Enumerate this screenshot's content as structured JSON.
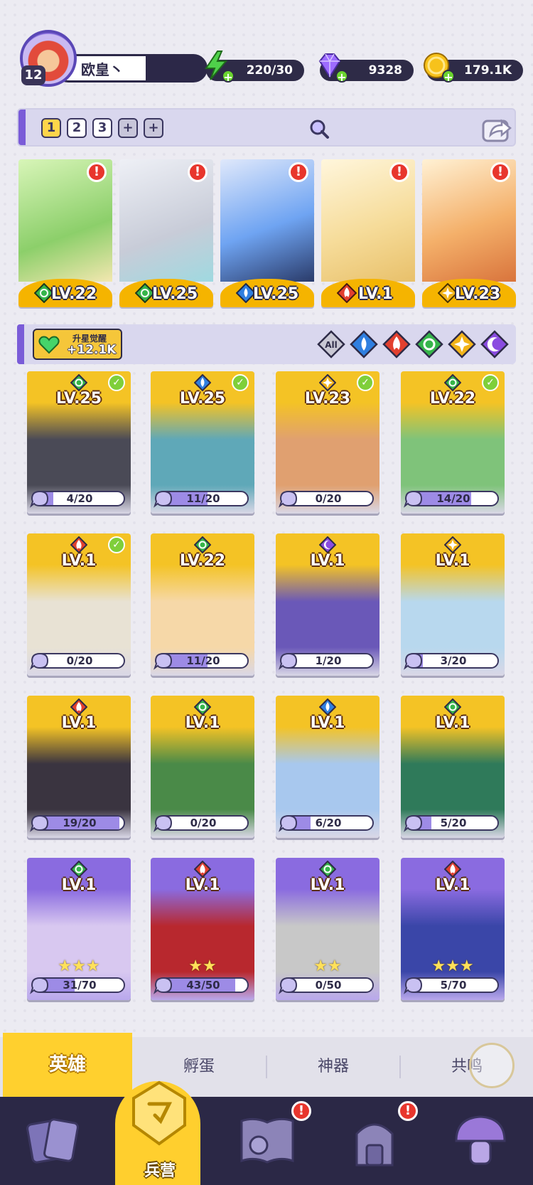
{
  "player": {
    "level": "12",
    "name": "欧皇丶"
  },
  "resources": [
    {
      "id": "energy",
      "value": "220/30",
      "icon": "lightning-icon",
      "color": "#4fd14a"
    },
    {
      "id": "gems",
      "value": "9328",
      "icon": "diamond-icon",
      "color": "#9d6cff"
    },
    {
      "id": "gold",
      "value": "179.1K",
      "icon": "coin-icon",
      "color": "#f7c21b"
    }
  ],
  "team_tabs": [
    "1",
    "2",
    "3",
    "+",
    "+"
  ],
  "team": [
    {
      "level": "LV.22",
      "element": "nature",
      "alert": "!"
    },
    {
      "level": "LV.25",
      "element": "nature",
      "alert": "!"
    },
    {
      "level": "LV.25",
      "element": "water",
      "alert": "!"
    },
    {
      "level": "LV.1",
      "element": "fire",
      "alert": "!"
    },
    {
      "level": "LV.23",
      "element": "light",
      "alert": "!"
    }
  ],
  "awaken": {
    "label": "升星觉醒",
    "value": "+12.1K"
  },
  "filters": [
    "All",
    "water",
    "fire",
    "nature",
    "light",
    "dark"
  ],
  "heroes": [
    {
      "level": "LV.25",
      "element": "nature",
      "checked": true,
      "progress": "4/20",
      "fraction": 0.2,
      "rarity": "gold"
    },
    {
      "level": "LV.25",
      "element": "water",
      "checked": true,
      "progress": "11/20",
      "fraction": 0.55,
      "rarity": "gold"
    },
    {
      "level": "LV.23",
      "element": "light",
      "checked": true,
      "progress": "0/20",
      "fraction": 0,
      "rarity": "gold"
    },
    {
      "level": "LV.22",
      "element": "nature",
      "checked": true,
      "progress": "14/20",
      "fraction": 0.7,
      "rarity": "gold"
    },
    {
      "level": "LV.1",
      "element": "fire",
      "checked": true,
      "progress": "0/20",
      "fraction": 0,
      "rarity": "gold"
    },
    {
      "level": "LV.22",
      "element": "nature",
      "checked": false,
      "progress": "11/20",
      "fraction": 0.55,
      "rarity": "gold"
    },
    {
      "level": "LV.1",
      "element": "dark",
      "checked": false,
      "progress": "1/20",
      "fraction": 0.05,
      "rarity": "gold"
    },
    {
      "level": "LV.1",
      "element": "light",
      "checked": false,
      "progress": "3/20",
      "fraction": 0.15,
      "rarity": "gold"
    },
    {
      "level": "LV.1",
      "element": "fire",
      "checked": false,
      "progress": "19/20",
      "fraction": 0.95,
      "rarity": "gold"
    },
    {
      "level": "LV.1",
      "element": "nature",
      "checked": false,
      "progress": "0/20",
      "fraction": 0,
      "rarity": "gold"
    },
    {
      "level": "LV.1",
      "element": "water",
      "checked": false,
      "progress": "6/20",
      "fraction": 0.3,
      "rarity": "gold"
    },
    {
      "level": "LV.1",
      "element": "nature",
      "checked": false,
      "progress": "5/20",
      "fraction": 0.25,
      "rarity": "gold"
    },
    {
      "level": "LV.1",
      "element": "nature",
      "checked": false,
      "progress": "31/70",
      "fraction": 0.44,
      "rarity": "purple",
      "stars": "★★★"
    },
    {
      "level": "LV.1",
      "element": "fire",
      "checked": false,
      "progress": "43/50",
      "fraction": 0.86,
      "rarity": "purple",
      "stars": "★★"
    },
    {
      "level": "LV.1",
      "element": "nature",
      "checked": false,
      "progress": "0/50",
      "fraction": 0,
      "rarity": "purple",
      "stars": "★★"
    },
    {
      "level": "LV.1",
      "element": "fire",
      "checked": false,
      "progress": "5/70",
      "fraction": 0.07,
      "rarity": "purple",
      "stars": "★★★"
    }
  ],
  "subtabs": [
    "英雄",
    "孵蛋",
    "神器",
    "共鸣"
  ],
  "bottom_nav": [
    {
      "id": "cards",
      "label": "",
      "icon": "cards-icon",
      "alert": ""
    },
    {
      "id": "barracks",
      "label": "兵营",
      "icon": "barracks-icon",
      "alert": ""
    },
    {
      "id": "book",
      "label": "",
      "icon": "book-icon",
      "alert": "!"
    },
    {
      "id": "shop",
      "label": "",
      "icon": "shop-icon",
      "alert": "!"
    },
    {
      "id": "guild",
      "label": "",
      "icon": "mushroom-icon",
      "alert": ""
    }
  ],
  "colors": {
    "water": "#2f7fe0",
    "fire": "#e2402f",
    "nature": "#36b54a",
    "light": "#f2b318",
    "dark": "#8a4ce0",
    "gold_card": "#f4c325",
    "purple_card": "#8a6be0"
  }
}
